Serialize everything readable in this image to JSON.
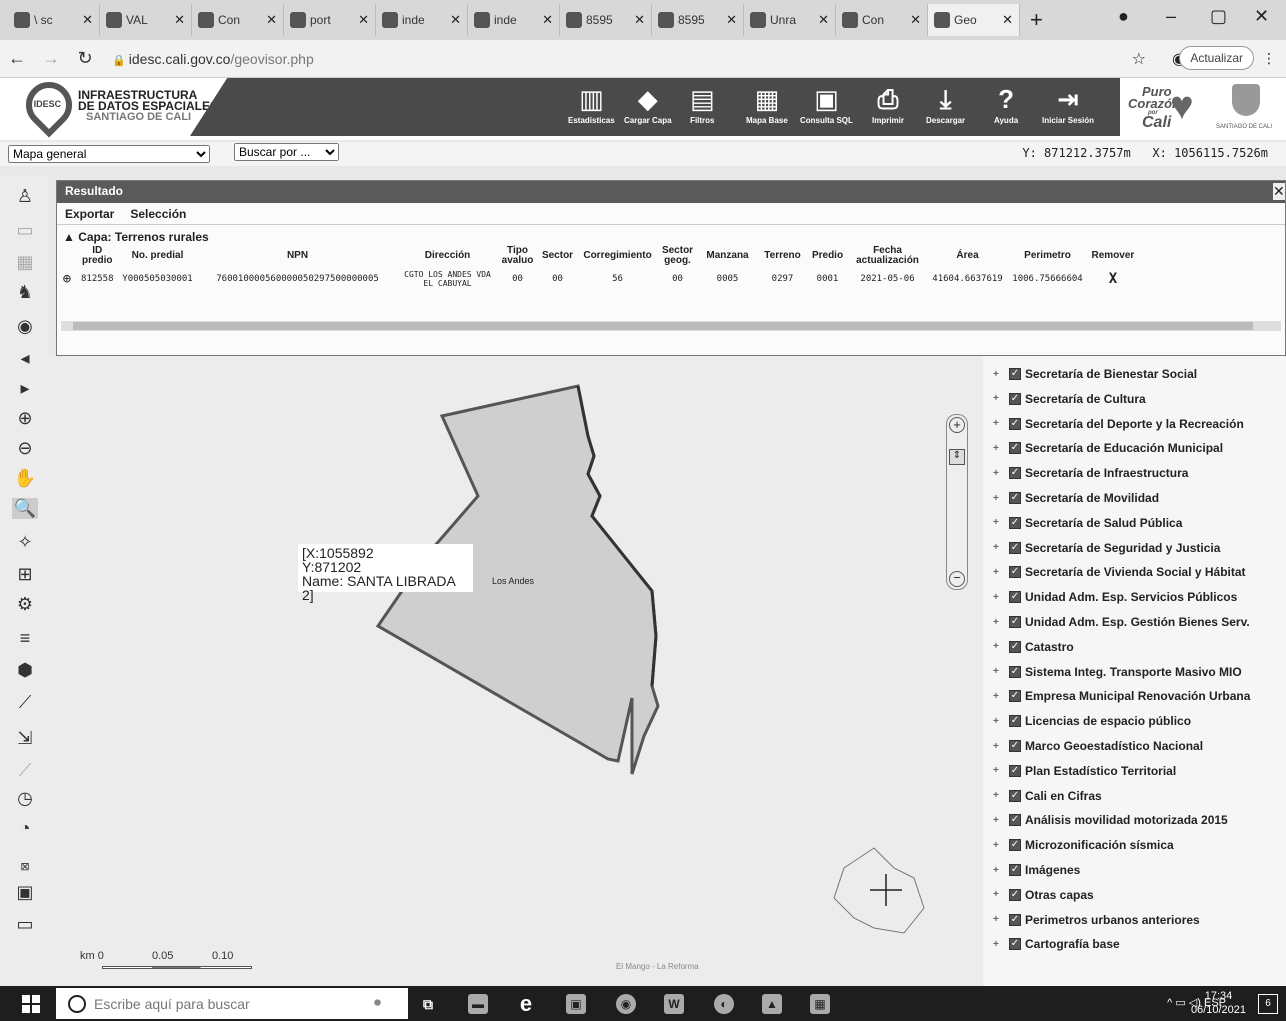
{
  "browser": {
    "tabs": [
      {
        "label": "\\ sc"
      },
      {
        "label": "VAL"
      },
      {
        "label": "Con"
      },
      {
        "label": "port"
      },
      {
        "label": "inde"
      },
      {
        "label": "inde"
      },
      {
        "label": "8595"
      },
      {
        "label": "8595"
      },
      {
        "label": "Unra"
      },
      {
        "label": "Con"
      },
      {
        "label": "Geo",
        "active": true
      }
    ],
    "url_host": "idesc.cali.gov.co",
    "url_path": "/geovisor.php",
    "update_label": "Actualizar"
  },
  "header": {
    "logo_badge": "IDESC",
    "logo_line1": "INFRAESTRUCTURA",
    "logo_line2": "DE DATOS ESPACIALES",
    "logo_line3": "SANTIAGO DE CALI",
    "tools": [
      {
        "label": "Estadísticas",
        "icon": "bar-chart-icon"
      },
      {
        "label": "Cargar Capa",
        "icon": "layers-icon"
      },
      {
        "label": "Filtros",
        "icon": "filter-icon"
      },
      {
        "label": "Mapa Base",
        "icon": "map-icon"
      },
      {
        "label": "Consulta SQL",
        "icon": "sql-icon"
      },
      {
        "label": "Imprimir",
        "icon": "printer-icon"
      },
      {
        "label": "Descargar",
        "icon": "download-icon"
      },
      {
        "label": "Ayuda",
        "icon": "help-icon"
      },
      {
        "label": "Iniciar Sesión",
        "icon": "login-icon"
      }
    ],
    "brand_line1": "Puro",
    "brand_line2": "Corazón",
    "brand_line3": "por",
    "brand_line4": "Cali",
    "seal_caption": "SANTIAGO DE CALI"
  },
  "controls": {
    "map_select": "Mapa general",
    "search_select": "Buscar por ...",
    "coord_y": "Y: 871212.3757m",
    "coord_x": "X: 1056115.7526m"
  },
  "result": {
    "title": "Resultado",
    "menu_export": "Exportar",
    "menu_select": "Selección",
    "layer_caption": "▲ Capa: Terrenos rurales",
    "columns": [
      "",
      "ID predio",
      "No. predial",
      "NPN",
      "Dirección",
      "Tipo avaluo",
      "Sector",
      "Corregimiento",
      "Sector geog.",
      "Manzana",
      "Terreno",
      "Predio",
      "Fecha actualización",
      "Área",
      "Perimetro",
      "Remover"
    ],
    "rows": [
      [
        "",
        "812558",
        "Y000505030001",
        "760010000560000050297500000005",
        "CGTO LOS ANDES VDA EL CABUYAL",
        "00",
        "00",
        "56",
        "00",
        "0005",
        "0297",
        "0001",
        "2021-05-06",
        "41604.6637619",
        "1006.75666604",
        "X"
      ]
    ]
  },
  "map": {
    "popup_x": "[X:1055892",
    "popup_y": "Y:871202",
    "popup_name": "Name: SANTA LIBRADA 2]",
    "place_label": "Los Andes",
    "road_label": "El Mango - La Reforma",
    "scale_unit": "km 0",
    "scale_mid": "0.05",
    "scale_end": "0.10"
  },
  "layers": [
    "Secretaría de Bienestar Social",
    "Secretaría de Cultura",
    "Secretaría del Deporte y la Recreación",
    "Secretaría de Educación Municipal",
    "Secretaría de Infraestructura",
    "Secretaría de Movilidad",
    "Secretaría de Salud Pública",
    "Secretaría de Seguridad y Justicia",
    "Secretaría de Vivienda Social y Hábitat",
    "Unidad Adm. Esp. Servicios Públicos",
    "Unidad Adm. Esp. Gestión Bienes Serv.",
    "Catastro",
    "Sistema Integ. Transporte Masivo MIO",
    "Empresa Municipal Renovación Urbana",
    "Licencias de espacio público",
    "Marco Geoestadístico Nacional",
    "Plan Estadístico Territorial",
    "Cali en Cifras",
    "Análisis movilidad motorizada 2015",
    "Microzonificación sísmica",
    "Imágenes",
    "Otras capas",
    "Perimetros urbanos anteriores",
    "Cartografía base"
  ],
  "taskbar": {
    "search_placeholder": "Escribe aquí para buscar",
    "lang": "ESP",
    "time": "17:34",
    "date": "06/10/2021",
    "notif_count": "6"
  }
}
